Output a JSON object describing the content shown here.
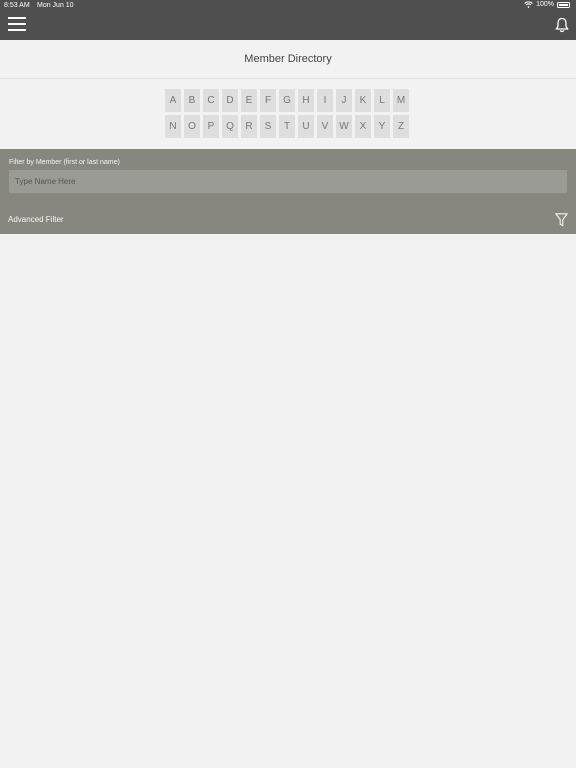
{
  "status_bar": {
    "time": "8:53 AM",
    "date": "Mon Jun 10",
    "battery": "100%"
  },
  "header": {
    "title": "Member Directory"
  },
  "alphabet": {
    "row1": [
      "A",
      "B",
      "C",
      "D",
      "E",
      "F",
      "G",
      "H",
      "I",
      "J",
      "K",
      "L",
      "M"
    ],
    "row2": [
      "N",
      "O",
      "P",
      "Q",
      "R",
      "S",
      "T",
      "U",
      "V",
      "W",
      "X",
      "Y",
      "Z"
    ]
  },
  "filter": {
    "label": "Filter by Member (first or last name)",
    "placeholder": "Type Name Here",
    "advanced_label": "Advanced Filter"
  },
  "icons": {
    "menu": "hamburger-menu-icon",
    "notifications": "bell-icon",
    "filter": "funnel-icon",
    "wifi": "wifi-icon",
    "battery": "battery-icon"
  },
  "colors": {
    "topbar": "#4f4f4f",
    "filter_panel": "#878780",
    "background": "#f2f2f2"
  }
}
